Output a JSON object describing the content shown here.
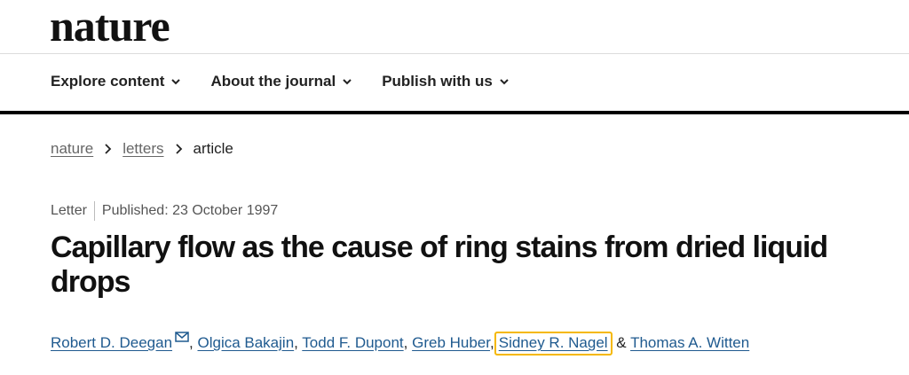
{
  "header": {
    "logo_text": "nature"
  },
  "nav": {
    "items": [
      {
        "label": "Explore content"
      },
      {
        "label": "About the journal"
      },
      {
        "label": "Publish with us"
      }
    ]
  },
  "breadcrumb": {
    "items": [
      "nature",
      "letters",
      "article"
    ]
  },
  "article": {
    "type": "Letter",
    "published": "Published: 23 October 1997",
    "title": "Capillary flow as the cause of ring stains from dried liquid drops",
    "authors": [
      {
        "name": "Robert D. Deegan",
        "sep": ", "
      },
      {
        "name": "Olgica Bakajin",
        "sep": ", "
      },
      {
        "name": "Todd F. Dupont",
        "sep": ", "
      },
      {
        "name": "Greb Huber",
        "sep": ","
      },
      {
        "name": "Sidney R. Nagel",
        "sep": " & "
      },
      {
        "name": "Thomas A. Witten",
        "sep": ""
      }
    ]
  },
  "colors": {
    "author_link": "#1f5a8f",
    "highlight": "#f5b800"
  },
  "icons": {
    "chevron": "chevron-down-icon",
    "breadcrumb_separator": "chevron-right-icon",
    "mail": "mail-icon"
  }
}
